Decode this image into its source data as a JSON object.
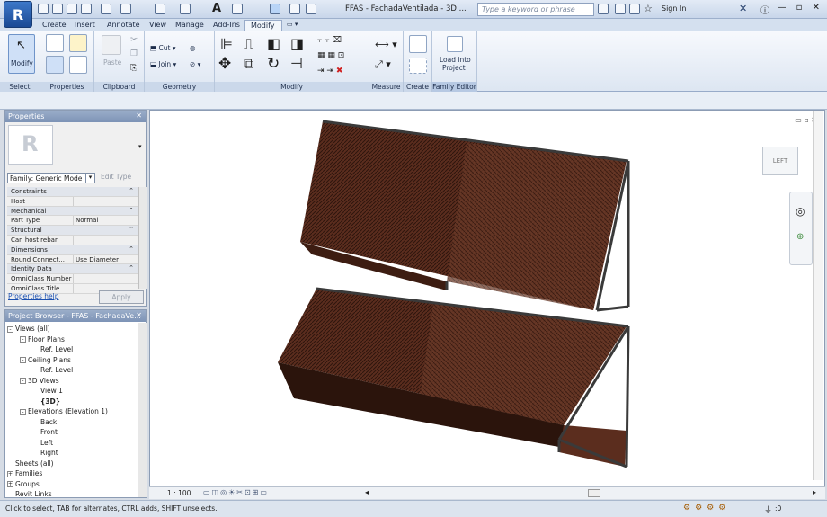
{
  "app": {
    "title": "FFAS - FachadaVentilada - 3D ...",
    "logo_letter": "R",
    "search_placeholder": "Type a keyword or phrase",
    "sign_in": "Sign In",
    "window_controls": "— ▫ ✕"
  },
  "tabs": [
    "Create",
    "Insert",
    "Annotate",
    "View",
    "Manage",
    "Add-Ins",
    "Modify"
  ],
  "ribbon": {
    "panels": [
      "Select",
      "Properties",
      "Clipboard",
      "Geometry",
      "Modify",
      "Measure",
      "Create",
      "Family Editor"
    ],
    "modify_label": "Modify",
    "paste_label": "Paste",
    "cut_label": "Cut",
    "join_label": "Join",
    "load_label_1": "Load into",
    "load_label_2": "Project"
  },
  "properties": {
    "title": "Properties",
    "family_select": "Family: Generic Mode",
    "edit_type": "Edit Type",
    "rows": [
      {
        "k": "Constraints",
        "v": "",
        "cat": true
      },
      {
        "k": "Host",
        "v": "",
        "cat": false
      },
      {
        "k": "Mechanical",
        "v": "",
        "cat": true
      },
      {
        "k": "Part Type",
        "v": "Normal",
        "cat": false
      },
      {
        "k": "Structural",
        "v": "",
        "cat": true
      },
      {
        "k": "Can host rebar",
        "v": "",
        "cat": false
      },
      {
        "k": "Dimensions",
        "v": "",
        "cat": true
      },
      {
        "k": "Round Connect...",
        "v": "Use Diameter",
        "cat": false
      },
      {
        "k": "Identity Data",
        "v": "",
        "cat": true
      },
      {
        "k": "OmniClass Number",
        "v": "",
        "cat": false
      },
      {
        "k": "OmniClass Title",
        "v": "",
        "cat": false
      }
    ],
    "help_link": "Properties help",
    "apply_label": "Apply"
  },
  "browser": {
    "title": "Project Browser - FFAS - FachadaVe...",
    "nodes": [
      {
        "label": "Views (all)",
        "depth": 0,
        "toggle": "-"
      },
      {
        "label": "Floor Plans",
        "depth": 1,
        "toggle": "-"
      },
      {
        "label": "Ref. Level",
        "depth": 2,
        "toggle": ""
      },
      {
        "label": "Ceiling Plans",
        "depth": 1,
        "toggle": "-"
      },
      {
        "label": "Ref. Level",
        "depth": 2,
        "toggle": ""
      },
      {
        "label": "3D Views",
        "depth": 1,
        "toggle": "-"
      },
      {
        "label": "View 1",
        "depth": 2,
        "toggle": ""
      },
      {
        "label": "{3D}",
        "depth": 2,
        "toggle": ""
      },
      {
        "label": "Elevations (Elevation 1)",
        "depth": 1,
        "toggle": "-"
      },
      {
        "label": "Back",
        "depth": 2,
        "toggle": ""
      },
      {
        "label": "Front",
        "depth": 2,
        "toggle": ""
      },
      {
        "label": "Left",
        "depth": 2,
        "toggle": ""
      },
      {
        "label": "Right",
        "depth": 2,
        "toggle": ""
      },
      {
        "label": "Sheets (all)",
        "depth": 0,
        "toggle": ""
      },
      {
        "label": "Families",
        "depth": 0,
        "toggle": "+"
      },
      {
        "label": "Groups",
        "depth": 0,
        "toggle": "+"
      },
      {
        "label": "Revit Links",
        "depth": 0,
        "toggle": ""
      }
    ]
  },
  "viewport": {
    "scale": "1 : 100",
    "viewcube_face": "LEFT",
    "controls": "▭ ▭ ▭"
  },
  "status": {
    "text": "Click to select, TAB for alternates, CTRL adds, SHIFT unselects.",
    "filter_count": ":0"
  },
  "colors": {
    "panel_brown": "#5b2d1e",
    "panel_dark": "#3d1d12",
    "frame": "#3a3a3a"
  }
}
